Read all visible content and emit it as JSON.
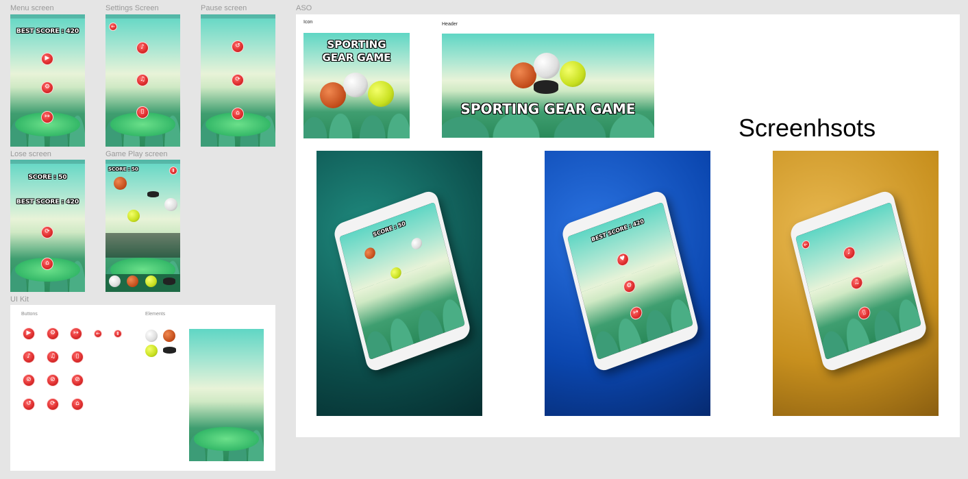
{
  "frames": {
    "menu_screen": "Menu screen",
    "settings_screen": "Settings Screen",
    "pause_screen": "Pause screen",
    "lose_screen": "Lose screen",
    "game_play_screen": "Game Play screen",
    "ui_kit": "UI Kit",
    "aso": "ASO"
  },
  "menu": {
    "best_score": "BEST SCORE : 420"
  },
  "lose": {
    "score": "SCORE : 50",
    "best_score": "BEST SCORE : 420"
  },
  "gameplay": {
    "score": "SCORE : 50"
  },
  "ui_kit": {
    "buttons_label": "Buttons",
    "elements_label": "Elements"
  },
  "aso": {
    "icon_label": "Icon",
    "header_label": "Header",
    "icon_title_line1": "SPORTING",
    "icon_title_line2": "GEAR GAME",
    "header_title": "SPORTING GEAR GAME",
    "screenshots_heading": "Screenhsots",
    "shot1_score": "SCORE : 50",
    "shot2_best": "BEST SCORE : 420"
  },
  "colors": {
    "button_red": "#e03030",
    "shot1_bg": "#0f5e5a",
    "shot2_bg": "#0b47b0",
    "shot3_bg": "#c8901e"
  },
  "icons": {
    "play": "play-icon",
    "settings": "gear-icon",
    "exit": "exit-icon",
    "back": "arrow-left-icon",
    "pause": "pause-icon",
    "sound": "speaker-icon",
    "music": "music-note-icon",
    "vibrate": "vibrate-icon",
    "restart": "restart-icon",
    "refresh": "refresh-icon",
    "home": "home-icon"
  }
}
